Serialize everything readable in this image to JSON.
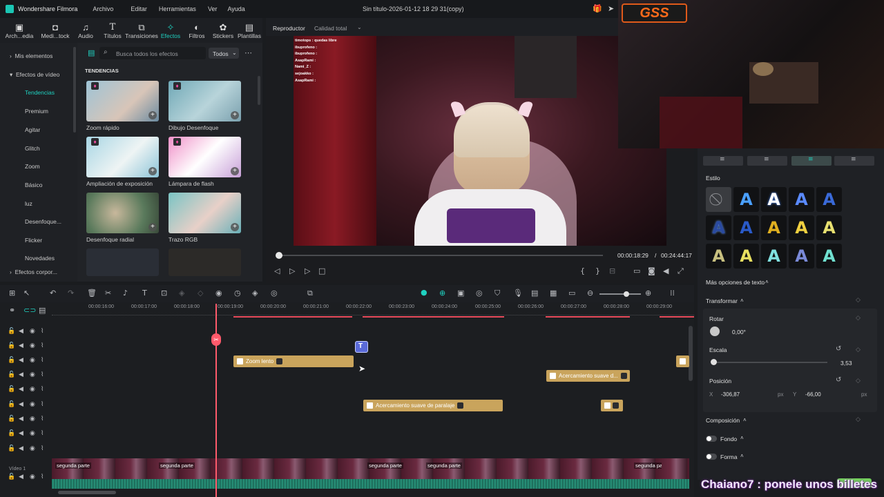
{
  "titlebar": {
    "app_name": "Wondershare Filmora",
    "menus": [
      "Archivo",
      "Editar",
      "Herramientas",
      "Ver",
      "Ayuda"
    ],
    "document_title": "Sin título-2026-01-12 18 29 31(copy)"
  },
  "toolbar": {
    "items": [
      {
        "label": "Arch...edia",
        "icon": "folder-icon"
      },
      {
        "label": "Medi...tock",
        "icon": "stock-icon"
      },
      {
        "label": "Audio",
        "icon": "music-icon"
      },
      {
        "label": "Títulos",
        "icon": "title-icon"
      },
      {
        "label": "Transiciones",
        "icon": "transition-icon"
      },
      {
        "label": "Efectos",
        "icon": "effects-icon"
      },
      {
        "label": "Filtros",
        "icon": "filter-icon"
      },
      {
        "label": "Stickers",
        "icon": "sticker-icon"
      },
      {
        "label": "Plantillas",
        "icon": "template-icon"
      }
    ],
    "active": "Efectos"
  },
  "leftnav": {
    "mis_elementos": "Mis elementos",
    "efectos_video": "Efectos de vídeo",
    "items": [
      "Tendencias",
      "Premium",
      "Agitar",
      "Glitch",
      "Zoom",
      "Básico",
      "luz",
      "Desenfoque...",
      "Flicker",
      "Novedades"
    ],
    "active": "Tendencias",
    "efectos_corpor": "Efectos corpor..."
  },
  "effects": {
    "search_placeholder": "Busca todos los efectos",
    "filter": "Todos",
    "section": "TENDENCIAS",
    "items": [
      "Zoom rápido",
      "Dibujo Desenfoque",
      "Ampliación de exposición",
      "Lámpara de flash",
      "Desenfoque radial",
      "Trazo RGB"
    ]
  },
  "player": {
    "tab": "Reproductor",
    "quality": "Calidad total",
    "current_time": "00:00:18:29",
    "total_time": "00:24:44:17",
    "progress": 0.012
  },
  "chat_overlay": [
    "timotops : quedas libre",
    "ibuprofeno :",
    "ibuprofeno :",
    "AsapRami :",
    "Nami_Z :",
    "sejoakko :",
    "AsapRami :"
  ],
  "properties": {
    "estilo_label": "Estilo",
    "mas_opciones": "Más opciones de texto",
    "transformar": "Transformar",
    "rotar_label": "Rotar",
    "rotar_value": "0,00°",
    "escala_label": "Escala",
    "escala_value": "3,53",
    "posicion_label": "Posición",
    "x_label": "X",
    "x_value": "-306,87",
    "y_label": "Y",
    "y_value": "-66,00",
    "px": "px",
    "composicion": "Composición",
    "fondo": "Fondo",
    "forma": "Forma"
  },
  "timeline": {
    "ticks": [
      "00:00:16:00",
      "00:00:17:00",
      "00:00:18:00",
      "00:00:19:00",
      "00:00:20:00",
      "00:00:21:00",
      "00:00:22:00",
      "00:00:23:00",
      "00:00:24:00",
      "00:00:25:00",
      "00:00:26:00",
      "00:00:27:00",
      "00:00:28:00",
      "00:00:29:00"
    ],
    "clips": {
      "zoom": "Zoom lento",
      "acerc1": "Acercamiento suave d...",
      "acerc2": "Acercamiento suave de paralaje"
    },
    "video_track_label": "Vídeo 1",
    "video_clip_labels": [
      "segunda parte",
      "segunda parte",
      "segunda parte",
      "segunda parte",
      "segunda parte"
    ]
  },
  "stream": {
    "logo_text": "GSS",
    "subtitle": "Chaiano7 : ponele unos billetes"
  }
}
